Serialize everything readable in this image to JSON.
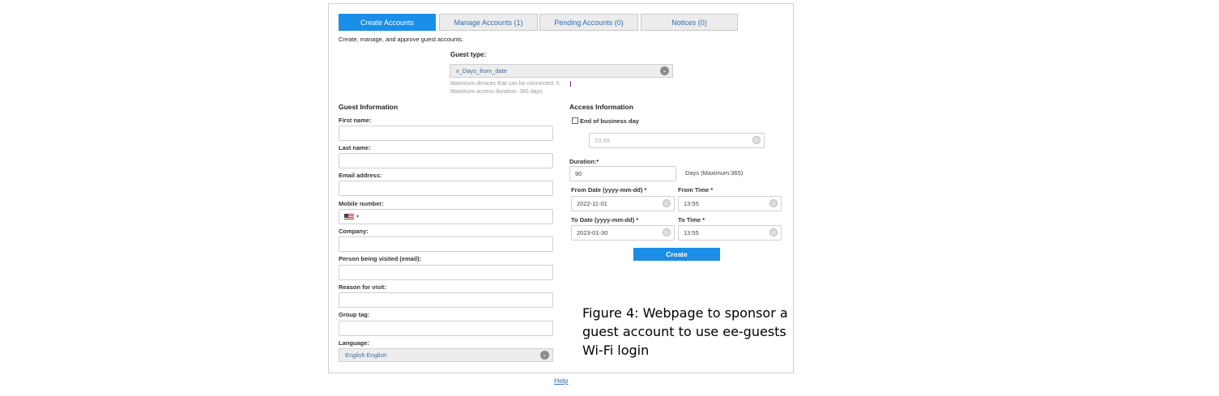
{
  "tabs": [
    {
      "label": "Create Accounts"
    },
    {
      "label": "Manage Accounts (1)"
    },
    {
      "label": "Pending Accounts (0)"
    },
    {
      "label": "Notices (0)"
    }
  ],
  "subtitle": "Create, manage, and approve guest accounts.",
  "guest_type": {
    "label": "Guest type:",
    "selected": "x_Days_from_date",
    "note1": "Maximum devices that can be connected: 5",
    "note2": "Maximum access duration: 365 days"
  },
  "guest_info": {
    "header": "Guest Information",
    "first_name": "First name:",
    "last_name": "Last name:",
    "email": "Email address:",
    "mobile": "Mobile number:",
    "company": "Company:",
    "person_visited": "Person being visited (email):",
    "reason": "Reason for visit:",
    "group_tag": "Group tag:",
    "language": "Language:",
    "language_value": "English   English"
  },
  "access_info": {
    "header": "Access Information",
    "end_of_day": "End of business day",
    "end_time": "23:59",
    "duration_label": "Duration:*",
    "duration_value": "90",
    "duration_hint": "Days (Maximum:365)",
    "from_date_label": "From Date (yyyy-mm-dd) *",
    "from_date_value": "2022-11-01",
    "from_time_label": "From Time *",
    "from_time_value": "13:55",
    "to_date_label": "To Date (yyyy-mm-dd) *",
    "to_date_value": "2023-01-30",
    "to_time_label": "To Time *",
    "to_time_value": "13:55"
  },
  "create_button": "Create",
  "caption": "Figure 4: Webpage to sponsor a guest account to use ee-guests Wi-Fi login",
  "help_link": "Help",
  "colors": {
    "accent": "#1a8ee8",
    "link": "#2f6fb7"
  }
}
